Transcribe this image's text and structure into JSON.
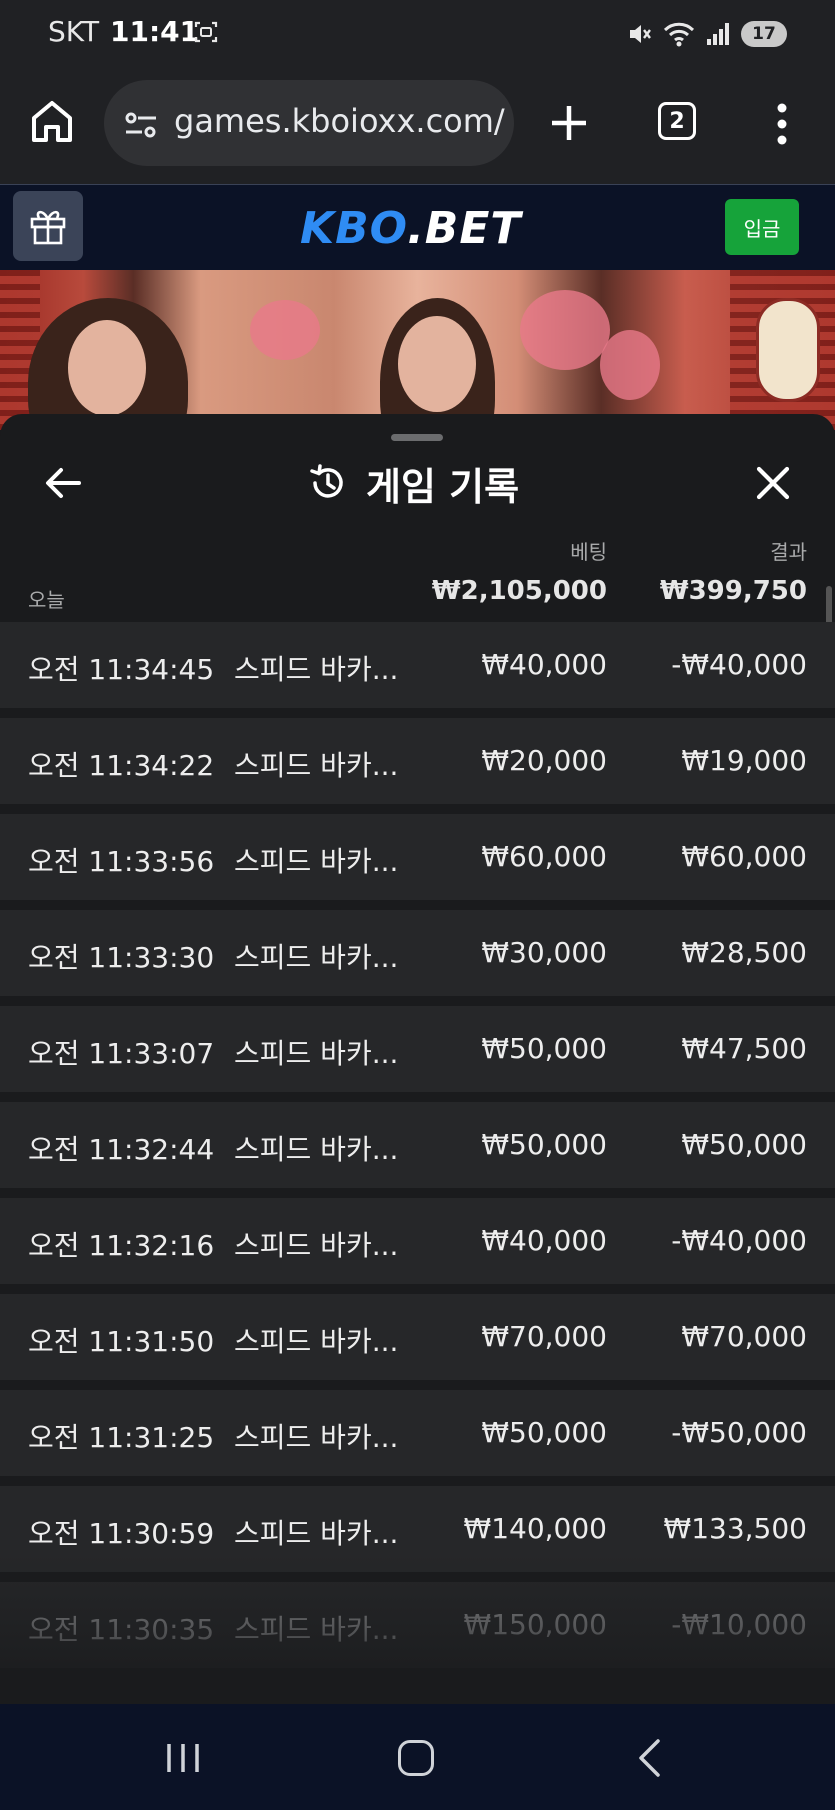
{
  "status_bar": {
    "carrier": "SKT",
    "time": "11:41",
    "battery": "17"
  },
  "browser": {
    "url": "games.kboioxx.com/",
    "tab_count": "2"
  },
  "site": {
    "logo_part1": "KBO",
    "logo_part2": ".BET",
    "deposit_label": "입금"
  },
  "history": {
    "title": "게임 기록",
    "bet_label": "베팅",
    "result_label": "결과",
    "today_label": "오늘",
    "total_bet": "₩2,105,000",
    "total_result": "₩399,750",
    "rows": [
      {
        "time": "오전 11:34:45",
        "game": "스피드 바카...",
        "bet": "₩40,000",
        "result": "-₩40,000"
      },
      {
        "time": "오전 11:34:22",
        "game": "스피드 바카...",
        "bet": "₩20,000",
        "result": "₩19,000"
      },
      {
        "time": "오전 11:33:56",
        "game": "스피드 바카...",
        "bet": "₩60,000",
        "result": "₩60,000"
      },
      {
        "time": "오전 11:33:30",
        "game": "스피드 바카...",
        "bet": "₩30,000",
        "result": "₩28,500"
      },
      {
        "time": "오전 11:33:07",
        "game": "스피드 바카...",
        "bet": "₩50,000",
        "result": "₩47,500"
      },
      {
        "time": "오전 11:32:44",
        "game": "스피드 바카...",
        "bet": "₩50,000",
        "result": "₩50,000"
      },
      {
        "time": "오전 11:32:16",
        "game": "스피드 바카...",
        "bet": "₩40,000",
        "result": "-₩40,000"
      },
      {
        "time": "오전 11:31:50",
        "game": "스피드 바카...",
        "bet": "₩70,000",
        "result": "₩70,000"
      },
      {
        "time": "오전 11:31:25",
        "game": "스피드 바카...",
        "bet": "₩50,000",
        "result": "-₩50,000"
      },
      {
        "time": "오전 11:30:59",
        "game": "스피드 바카...",
        "bet": "₩140,000",
        "result": "₩133,500"
      },
      {
        "time": "오전 11:30:35",
        "game": "스피드 바카...",
        "bet": "₩150,000",
        "result": "-₩10,000"
      }
    ]
  },
  "icons": {
    "home": "home-icon",
    "tune": "tune-icon",
    "add": "plus-icon",
    "menu": "more-vert-icon",
    "gift": "gift-icon",
    "history": "history-icon",
    "back": "arrow-left-icon",
    "close": "close-icon"
  }
}
